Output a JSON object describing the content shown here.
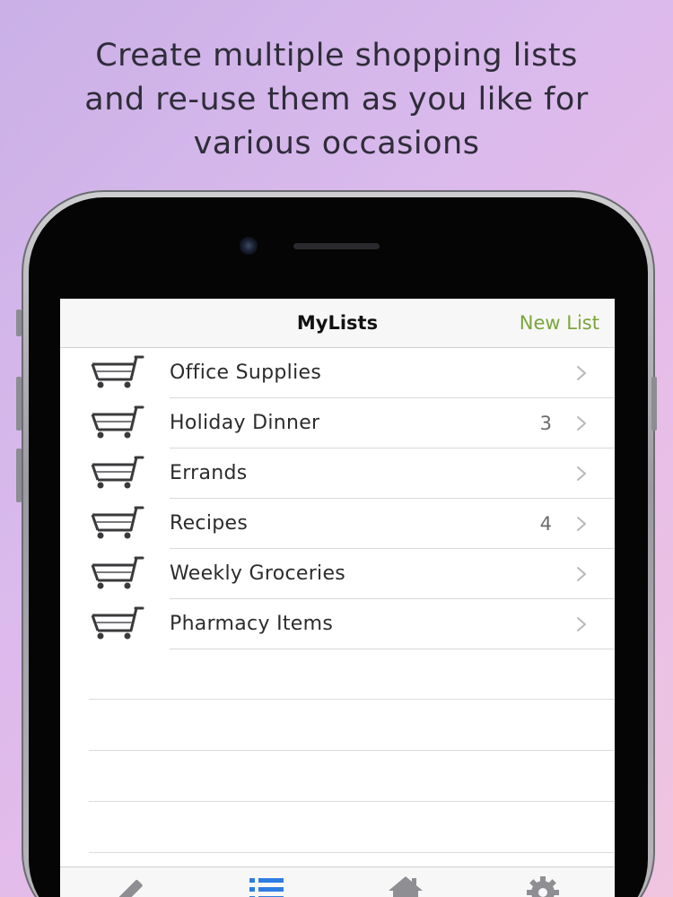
{
  "promo": {
    "line1": "Create multiple shopping lists",
    "line2": "and re-use them as you like for",
    "line3": "various occasions"
  },
  "navbar": {
    "title": "MyLists",
    "action_label": "New List",
    "action_color": "#7aa63a"
  },
  "lists": [
    {
      "name": "Office Supplies",
      "count": ""
    },
    {
      "name": "Holiday Dinner",
      "count": "3"
    },
    {
      "name": "Errands",
      "count": ""
    },
    {
      "name": "Recipes",
      "count": "4"
    },
    {
      "name": "Weekly Groceries",
      "count": ""
    },
    {
      "name": "Pharmacy Items",
      "count": ""
    }
  ],
  "row_icon": "shopping-cart-icon",
  "row_accessory_icon": "chevron-right-icon",
  "tabbar": {
    "tabs": [
      {
        "icon": "pencil-icon",
        "selected": false
      },
      {
        "icon": "list-icon",
        "selected": true
      },
      {
        "icon": "home-icon",
        "selected": false
      },
      {
        "icon": "gear-icon",
        "selected": false
      }
    ],
    "selected_color": "#2f7de1",
    "unselected_color": "#8e8e93"
  }
}
